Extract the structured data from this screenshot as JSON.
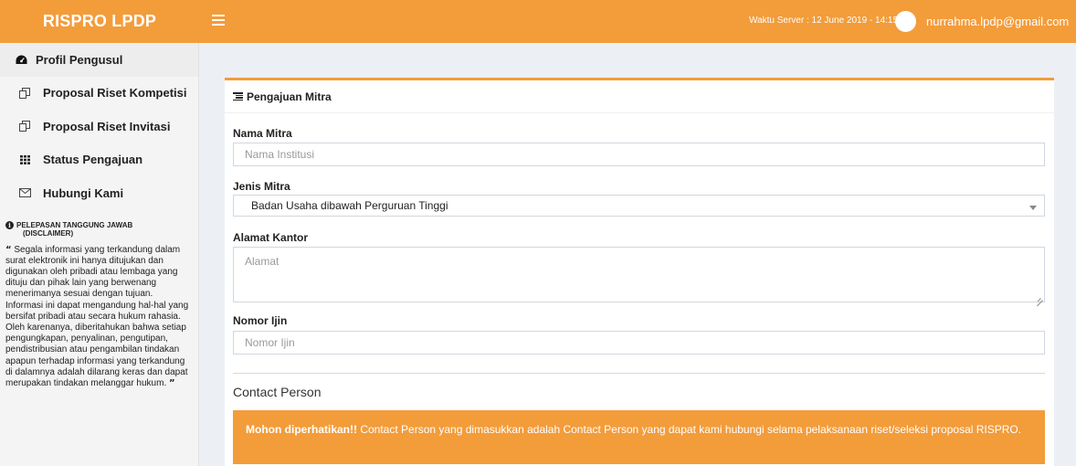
{
  "header": {
    "brand": "RISPRO LPDP",
    "server_time": "Waktu Server : 12 June 2019 - 14:15",
    "user_email": "nurrahma.lpdp@gmail.com"
  },
  "sidebar": {
    "items": [
      {
        "label": "Profil Pengusul",
        "icon": "dashboard-icon"
      },
      {
        "label": "Proposal Riset Kompetisi",
        "icon": "copy-icon"
      },
      {
        "label": "Proposal Riset Invitasi",
        "icon": "copy-icon"
      },
      {
        "label": "Status Pengajuan",
        "icon": "grid-icon"
      },
      {
        "label": "Hubungi Kami",
        "icon": "envelope-icon"
      }
    ],
    "disclaimer": {
      "title_line1": "PELEPASAN TANGGUNG JAWAB",
      "title_line2": "(DISCLAIMER)",
      "body": "Segala informasi yang terkandung dalam surat elektronik ini hanya ditujukan dan digunakan oleh pribadi atau lembaga yang dituju dan pihak lain yang berwenang menerimanya sesuai dengan tujuan. Informasi ini dapat mengandung hal-hal yang bersifat pribadi atau secara hukum rahasia. Oleh karenanya, diberitahukan bahwa setiap pengungkapan, penyalinan, pengutipan, pendistribusian atau pengambilan tindakan apapun terhadap informasi yang terkandung di dalamnya adalah dilarang keras dan dapat merupakan tindakan melanggar hukum."
    }
  },
  "form": {
    "title": "Pengajuan Mitra",
    "nama_mitra": {
      "label": "Nama Mitra",
      "placeholder": "Nama Institusi",
      "value": ""
    },
    "jenis_mitra": {
      "label": "Jenis Mitra",
      "selected": "Badan Usaha dibawah Perguruan Tinggi"
    },
    "alamat_kantor": {
      "label": "Alamat Kantor",
      "placeholder": "Alamat",
      "value": ""
    },
    "nomor_ijin": {
      "label": "Nomor Ijin",
      "placeholder": "Nomor Ijin",
      "value": ""
    },
    "contact_section": "Contact Person",
    "alert": {
      "strong": "Mohon diperhatikan!!",
      "text": " Contact Person yang dimasukkan adalah Contact Person yang dapat kami hubungi selama pelaksanaan riset/seleksi proposal RISPRO."
    }
  },
  "colors": {
    "accent": "#f39c3a",
    "sidebar_bg": "#f4f4f4",
    "page_bg": "#ecf0f5"
  }
}
